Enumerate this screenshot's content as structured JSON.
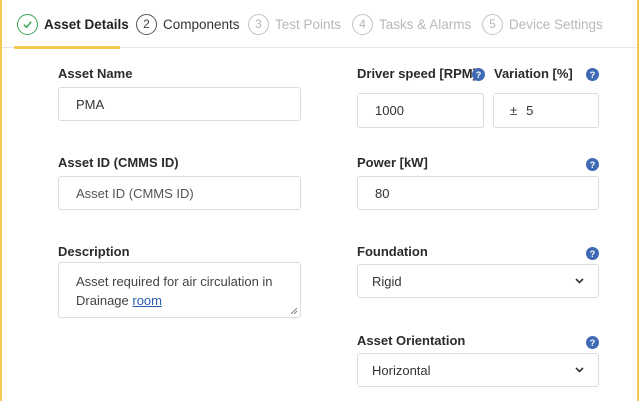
{
  "stepper": {
    "steps": [
      {
        "number": "✓",
        "label": "Asset Details",
        "state": "active"
      },
      {
        "number": "2",
        "label": "Components",
        "state": "available"
      },
      {
        "number": "3",
        "label": "Test Points",
        "state": "disabled"
      },
      {
        "number": "4",
        "label": "Tasks & Alarms",
        "state": "disabled"
      },
      {
        "number": "5",
        "label": "Device Settings",
        "state": "disabled"
      }
    ]
  },
  "form": {
    "asset_name": {
      "label": "Asset Name",
      "value": "PMA"
    },
    "asset_id": {
      "label": "Asset ID (CMMS ID)",
      "placeholder": "Asset ID (CMMS ID)"
    },
    "description": {
      "label": "Description",
      "value_part1": "Asset required for air circulation in",
      "value_part2": "Drainage ",
      "value_link": "room"
    },
    "driver_speed": {
      "label": "Driver speed [RPM]",
      "value": "1000"
    },
    "variation": {
      "label": "Variation [%]",
      "prefix": "±",
      "value": "5"
    },
    "power": {
      "label": "Power [kW]",
      "value": "80"
    },
    "foundation": {
      "label": "Foundation",
      "selected": "Rigid"
    },
    "asset_orientation": {
      "label": "Asset Orientation",
      "selected": "Horizontal"
    },
    "help_glyph": "?"
  },
  "colors": {
    "accent": "#f2c94c",
    "active_step": "#3aa655",
    "help_icon": "#3f6ab3",
    "link": "#2a5db0"
  }
}
